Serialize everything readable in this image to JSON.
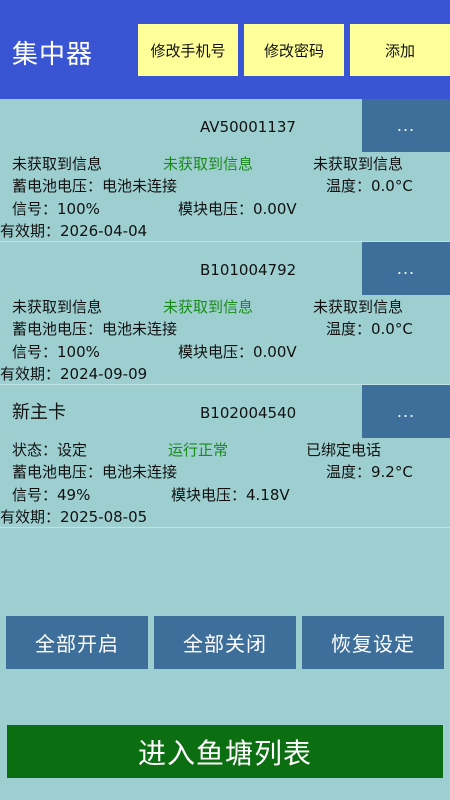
{
  "header": {
    "title": "集中器",
    "change_phone": "修改手机号",
    "change_password": "修改密码",
    "add": "添加"
  },
  "devices": [
    {
      "name": "",
      "id": "AV50001137",
      "more": "...",
      "status_left": "未获取到信息",
      "status_mid": "未获取到信息",
      "status_right": "未获取到信息",
      "battery": "蓄电池电压：电池未连接",
      "temperature": "温度：0.0°C",
      "signal": "信号：100%",
      "module_voltage": "模块电压：0.00V",
      "expiry": "有效期：2026-04-04"
    },
    {
      "name": "",
      "id": "B101004792",
      "more": "...",
      "status_left": "未获取到信息",
      "status_mid": "未获取到信息",
      "status_right": "未获取到信息",
      "battery": "蓄电池电压：电池未连接",
      "temperature": "温度：0.0°C",
      "signal": "信号：100%",
      "module_voltage": "模块电压：0.00V",
      "expiry": "有效期：2024-09-09"
    },
    {
      "name": "新主卡",
      "id": "B102004540",
      "more": "...",
      "status_left": "状态：设定",
      "status_mid": "运行正常",
      "status_right": "已绑定电话",
      "battery": "蓄电池电压：电池未连接",
      "temperature": "温度：9.2°C",
      "signal": "信号：49%",
      "module_voltage": "模块电压：4.18V",
      "expiry": "有效期：2025-08-05"
    }
  ],
  "actions": {
    "all_on": "全部开启",
    "all_off": "全部关闭",
    "restore": "恢复设定",
    "enter_pond_list": "进入鱼塘列表"
  },
  "colors": {
    "header_bg": "#3a55d3",
    "header_button_bg": "#ffff9a",
    "page_bg": "#9ecfd0",
    "action_button_bg": "#3e6e9a",
    "enter_button_bg": "#0b6e11",
    "status_ok": "#1a8a1a"
  }
}
